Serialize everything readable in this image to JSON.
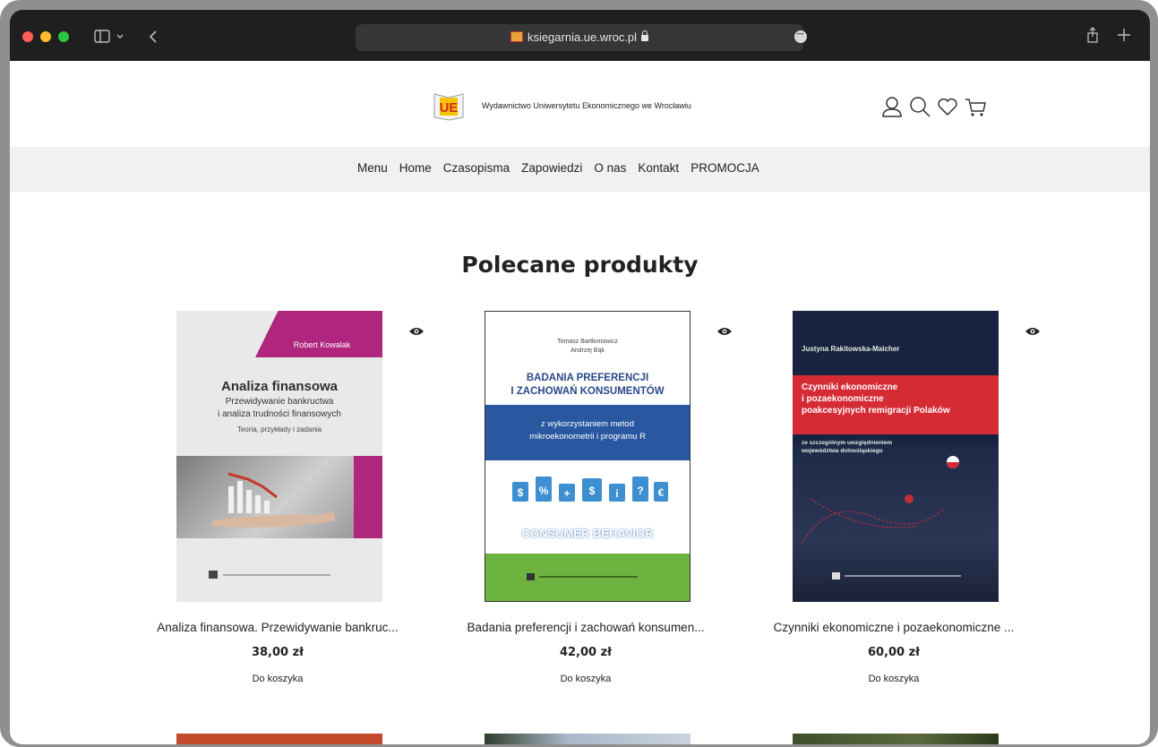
{
  "browser": {
    "url": "ksiegarnia.ue.wroc.pl",
    "icons": [
      "sidebar-icon",
      "chevron-down-icon",
      "back-icon",
      "share-icon",
      "new-tab-icon",
      "page-menu-icon"
    ]
  },
  "header": {
    "brand_name": "Wydawnictwo Uniwersytetu Ekonomicznego we Wrocławiu",
    "logo_letters": "UE",
    "icons": [
      "user-icon",
      "search-icon",
      "heart-icon",
      "cart-icon"
    ]
  },
  "nav": {
    "items": [
      "Menu",
      "Home",
      "Czasopisma",
      "Zapowiedzi",
      "O nas",
      "Kontakt",
      "PROMOCJA"
    ]
  },
  "main": {
    "section_title": "Polecane produkty",
    "products": [
      {
        "title": "Analiza finansowa. Przewidywanie bankruc...",
        "price": "38,00 zł",
        "cart_label": "Do koszyka",
        "cover": {
          "author": "Robert Kowalak",
          "title": "Analiza finansowa",
          "subtitle1": "Przewidywanie bankructwa",
          "subtitle2": "i analiza trudności finansowych",
          "subtitle3": "Teoria, przykłady i zadania",
          "bg": "#e9e9e9",
          "accent": "#b0257d"
        }
      },
      {
        "title": "Badania preferencji i zachowań konsumen...",
        "price": "42,00 zł",
        "cart_label": "Do koszyka",
        "cover": {
          "author1": "Tomasz Bartłomowicz",
          "author2": "Andrzej Bąk",
          "title1": "BADANIA PREFERENCJI",
          "title2": "I ZACHOWAŃ KONSUMENTÓW",
          "band1": "z wykorzystaniem metod",
          "band2": "mikroekonometrii i programu R",
          "art_text": "CONSUMER BEHAVIOR",
          "bg": "#ffffff",
          "band": "#2a58a0",
          "footer": "#6cb33f"
        }
      },
      {
        "title": "Czynniki ekonomiczne i pozaekonomiczne ...",
        "price": "60,00 zł",
        "cart_label": "Do koszyka",
        "cover": {
          "author": "Justyna Rakitowska-Malcher",
          "title1": "Czynniki ekonomiczne",
          "title2": "i pozaekonomiczne",
          "title3": "poakcesyjnych remigracji Polaków",
          "sub1": "ze szczególnym uwzględnieniem",
          "sub2": "województwa dolnośląskiego",
          "bg": "#17243f",
          "band": "#d42b35"
        }
      }
    ]
  }
}
